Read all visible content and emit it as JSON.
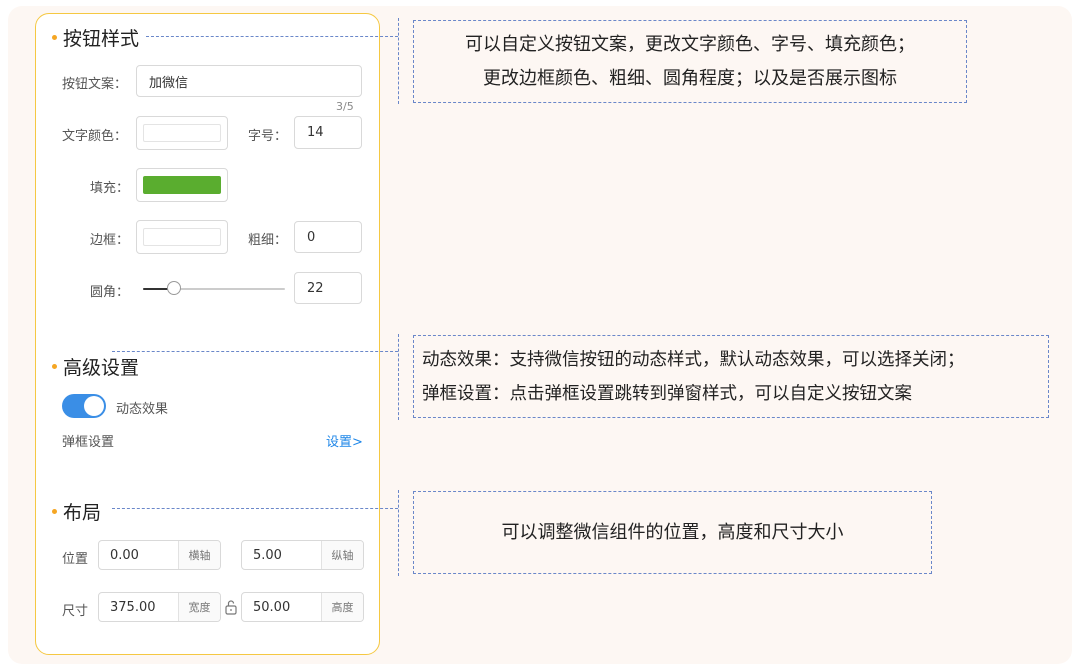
{
  "panel": {
    "button_style": {
      "title": "按钮样式",
      "text_label": "按钮文案：",
      "text_value": "加微信",
      "text_counter": "3/5",
      "font_color_label": "文字颜色：",
      "font_size_label": "字号：",
      "font_size_value": "14",
      "fill_label": "填充：",
      "fill_color": "#5aad2f",
      "border_label": "边框：",
      "border_width_label": "粗细：",
      "border_width_value": "0",
      "radius_label": "圆角：",
      "radius_value": "22"
    },
    "advanced": {
      "title": "高级设置",
      "dynamic_label": "动态效果",
      "dynamic_on": true,
      "popup_label": "弹框设置",
      "popup_link": "设置>"
    },
    "layout": {
      "title": "布局",
      "position_label": "位置",
      "x_value": "0.00",
      "x_unit": "横轴",
      "y_value": "5.00",
      "y_unit": "纵轴",
      "size_label": "尺寸",
      "width_value": "375.00",
      "width_unit": "宽度",
      "height_value": "50.00",
      "height_unit": "高度"
    }
  },
  "callouts": {
    "button_style": {
      "line1": "可以自定义按钮文案，更改文字颜色、字号、填充颜色；",
      "line2": "更改边框颜色、粗细、圆角程度；以及是否展示图标"
    },
    "advanced": {
      "line1": "动态效果：支持微信按钮的动态样式，默认动态效果，可以选择关闭；",
      "line2": "弹框设置：点击弹框设置跳转到弹窗样式，可以自定义按钮文案"
    },
    "layout": {
      "line1": "可以调整微信组件的位置，高度和尺寸大小"
    }
  },
  "colors": {
    "panel_border": "#f5c842",
    "accent": "#3a8ee6",
    "callout_border": "#6a87c9"
  }
}
